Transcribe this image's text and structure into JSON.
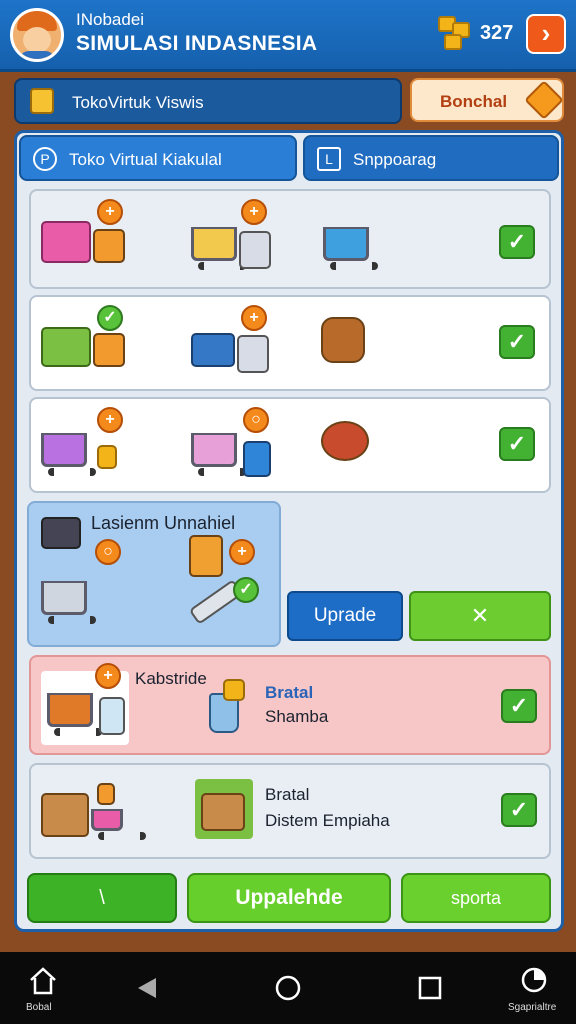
{
  "header": {
    "subtitle": "INobadei",
    "title": "SIMULASI INDASNESIA",
    "coins": "327",
    "exit_glyph": "›"
  },
  "store_bar": {
    "label": "TokoVirtuk Viswis"
  },
  "bonus_button": {
    "label": "Bonchal"
  },
  "tabs": [
    {
      "label": "Toko Virtual Kiakulal",
      "icon": "shop-icon"
    },
    {
      "label": "Snppoarag",
      "icon": "storage-icon"
    }
  ],
  "check_glyph": "✓",
  "large_card": {
    "title": "Lasienm Unnahiel"
  },
  "actions": {
    "upgrade_label": "Uprade",
    "close_label": "✕"
  },
  "rows": {
    "pink_tag": "Kabstride",
    "pink_title": "Bratal",
    "pink_sub": "Shamba",
    "last_title": "Bratal",
    "last_sub": "Distem Empiaha"
  },
  "footer": {
    "left_label": "\\",
    "center_label": "Uppalehde",
    "right_label": "sporta"
  },
  "nav": {
    "home_label": "Bobal",
    "right_label": "Sgaprialtre"
  },
  "colors": {
    "header_blue": "#1e74c9",
    "panel_bg": "#e3eaf2",
    "check_green": "#43b233",
    "pink_row": "#f7c6c6",
    "accent_orange": "#ef5a1a"
  }
}
